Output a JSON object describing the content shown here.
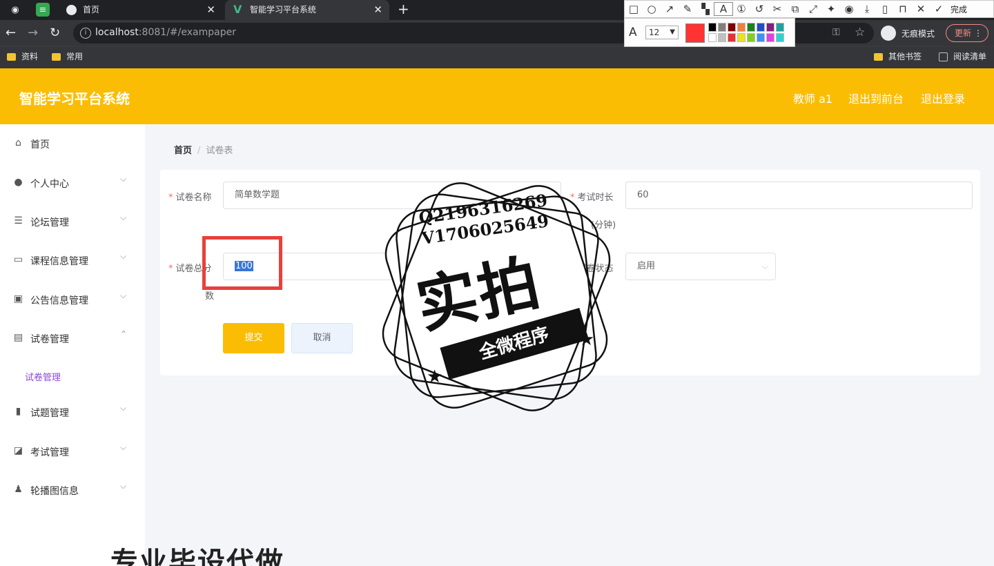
{
  "browser": {
    "tabs": [
      {
        "title": "首页"
      },
      {
        "title": "智能学习平台系统"
      }
    ],
    "url_host": "localhost",
    "url_rest": ":8081/#/exampaper",
    "incognito_label": "无痕模式",
    "update_label": "更新",
    "bookmarks": [
      "资料",
      "常用"
    ],
    "bookmarks_right": [
      "其他书签",
      "阅读清单"
    ]
  },
  "snap_tool": {
    "done_label": "完成",
    "font_size": "12",
    "palette": [
      "#000000",
      "#808080",
      "#800000",
      "#f08040",
      "#208020",
      "#2050c0",
      "#802080",
      "#20a0a0",
      "#ffffff",
      "#c0c0c0",
      "#e83030",
      "#f0e020",
      "#80d020",
      "#4090f0",
      "#e040e0",
      "#30d0d0"
    ]
  },
  "header": {
    "app_title": "智能学习平台系统",
    "user": "教师 a1",
    "back_front": "退出到前台",
    "logout": "退出登录"
  },
  "sidebar": {
    "items": [
      {
        "label": "首页",
        "icon": "home-icon"
      },
      {
        "label": "个人中心",
        "icon": "user-icon"
      },
      {
        "label": "论坛管理",
        "icon": "sliders-icon"
      },
      {
        "label": "课程信息管理",
        "icon": "card-icon"
      },
      {
        "label": "公告信息管理",
        "icon": "clipboard-icon"
      },
      {
        "label": "试卷管理",
        "icon": "stack-icon"
      },
      {
        "label": "试题管理",
        "icon": "bar-chart-icon"
      },
      {
        "label": "考试管理",
        "icon": "trend-icon"
      },
      {
        "label": "轮播图信息",
        "icon": "person-icon"
      }
    ],
    "sub_item": "试卷管理"
  },
  "breadcrumb": {
    "home": "首页",
    "current": "试卷表"
  },
  "form": {
    "name_label": "试卷名称",
    "name_value": "简单数学题",
    "duration_label": "考试时长",
    "duration_unit": "(分钟)",
    "duration_value": "60",
    "score_label": "试卷总分",
    "score_label_wrap": "数",
    "score_value": "100",
    "status_label": "试卷状态",
    "status_value": "启用",
    "submit": "提交",
    "cancel": "取消"
  },
  "watermark": {
    "contact_q": "Q2196316269",
    "contact_v": "V1706025649",
    "big": "实拍",
    "ribbon": "全微程序",
    "bottom": "专业毕设代做"
  }
}
